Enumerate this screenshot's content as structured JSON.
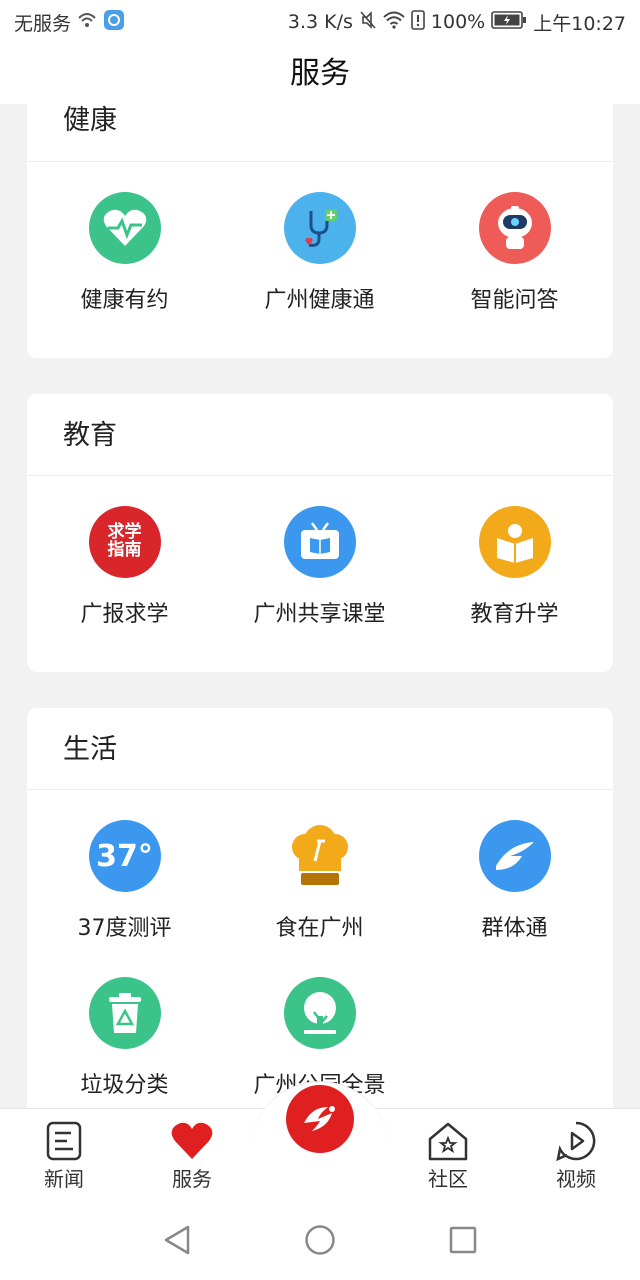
{
  "status": {
    "carrier": "无服务",
    "speed": "3.3 K/s",
    "battery": "100%",
    "time": "上午10:27"
  },
  "header": {
    "title": "服务"
  },
  "sections": [
    {
      "title": "健康",
      "items": [
        {
          "label": "健康有约",
          "icon": "heart-pulse-icon",
          "color": "#3cc38a"
        },
        {
          "label": "广州健康通",
          "icon": "stethoscope-icon",
          "color": "#4cb2ec"
        },
        {
          "label": "智能问答",
          "icon": "robot-icon",
          "color": "#ef5b57"
        }
      ]
    },
    {
      "title": "教育",
      "items": [
        {
          "label": "广报求学",
          "icon": "study-guide-icon",
          "color": "#d8262b",
          "badge_top": "求学",
          "badge_bottom": "指南"
        },
        {
          "label": "广州共享课堂",
          "icon": "tv-book-icon",
          "color": "#3c97ee"
        },
        {
          "label": "教育升学",
          "icon": "reader-book-icon",
          "color": "#f2a91a"
        }
      ]
    },
    {
      "title": "生活",
      "items": [
        {
          "label": "37度测评",
          "icon": "thermometer-37-icon",
          "color": "#3c97ee",
          "badge": "37°"
        },
        {
          "label": "食在广州",
          "icon": "chef-hat-icon",
          "color": "#f2a91a"
        },
        {
          "label": "群体通",
          "icon": "group-swoosh-icon",
          "color": "#3c97ee"
        },
        {
          "label": "垃圾分类",
          "icon": "trash-bin-icon",
          "color": "#3cc38a"
        },
        {
          "label": "广州公园全景",
          "icon": "tree-icon",
          "color": "#3cc38a"
        }
      ]
    }
  ],
  "nav": {
    "news": "新闻",
    "services": "服务",
    "community": "社区",
    "video": "视频"
  },
  "colors": {
    "accent": "#e02020",
    "background": "#f2f2f2"
  }
}
